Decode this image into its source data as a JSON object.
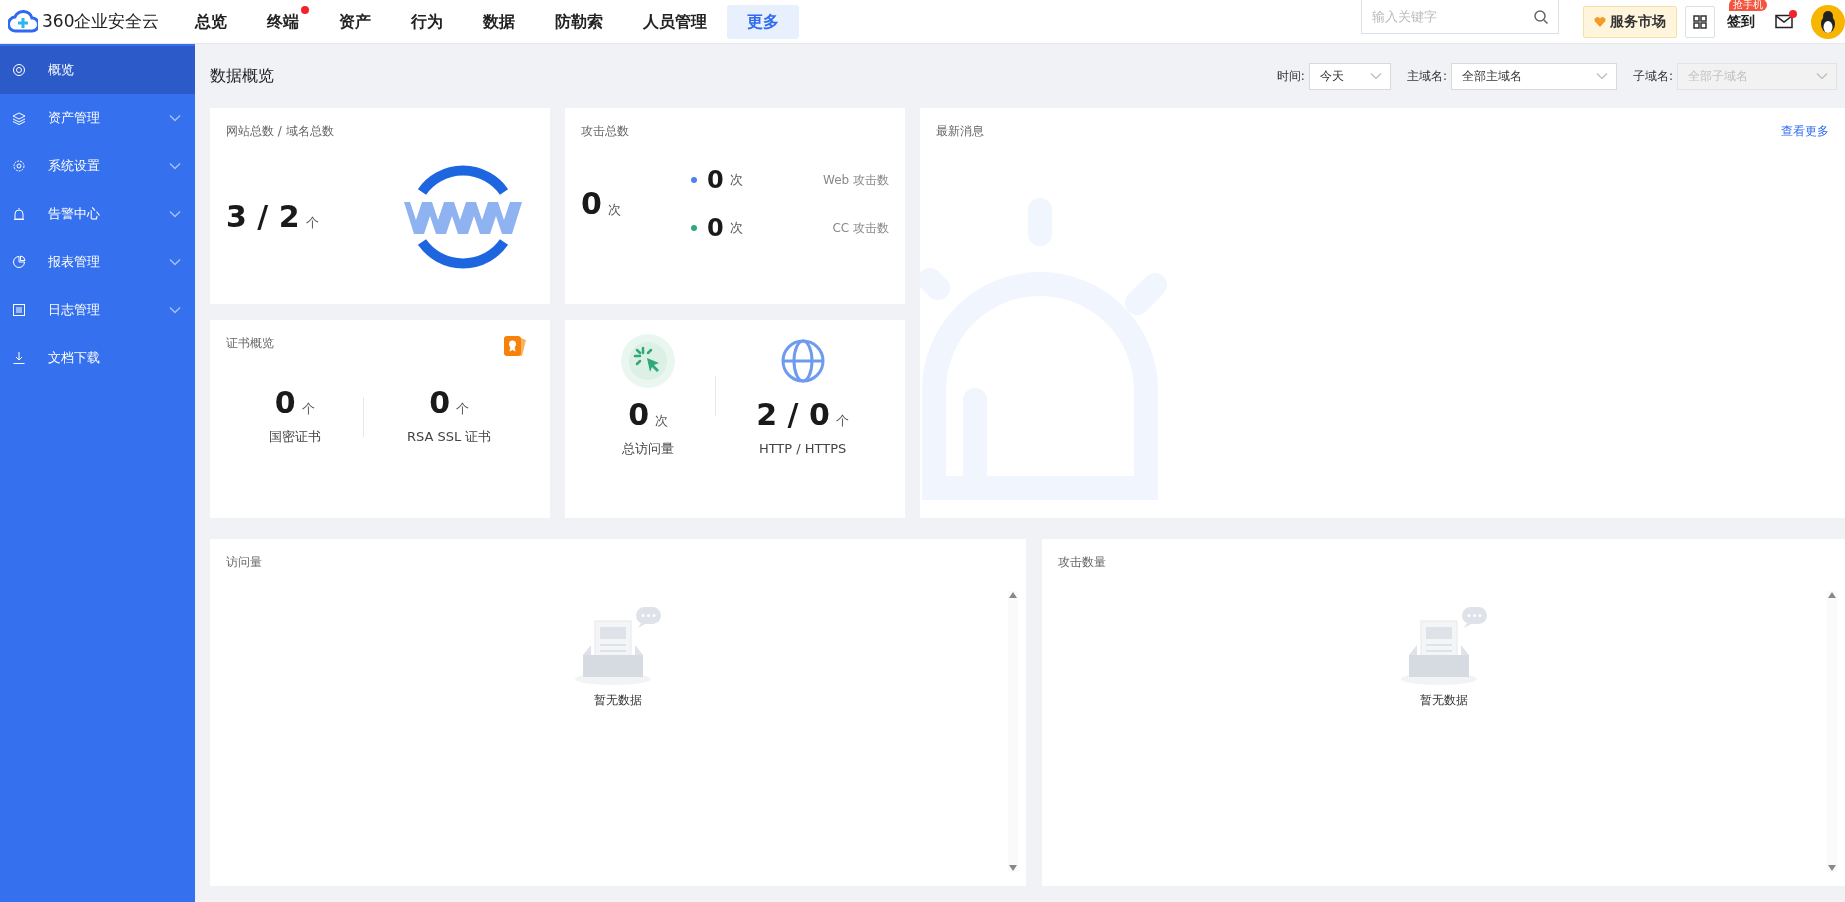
{
  "brand": {
    "name": "360企业安全云"
  },
  "nav": [
    {
      "label": "总览",
      "selected": false,
      "dot": false
    },
    {
      "label": "终端",
      "selected": false,
      "dot": true
    },
    {
      "label": "资产",
      "selected": false,
      "dot": false
    },
    {
      "label": "行为",
      "selected": false,
      "dot": false
    },
    {
      "label": "数据",
      "selected": false,
      "dot": false
    },
    {
      "label": "防勒索",
      "selected": false,
      "dot": false
    },
    {
      "label": "人员管理",
      "selected": false,
      "dot": false
    },
    {
      "label": "更多",
      "selected": true,
      "dot": false
    }
  ],
  "search": {
    "placeholder": "输入关键字"
  },
  "market_button": "服务市场",
  "checkin": {
    "label": "签到",
    "badge": "抢手机"
  },
  "mail": {
    "dot": true
  },
  "sidebar": {
    "items": [
      {
        "label": "概览",
        "selected": true,
        "expandable": false
      },
      {
        "label": "资产管理",
        "selected": false,
        "expandable": true
      },
      {
        "label": "系统设置",
        "selected": false,
        "expandable": true
      },
      {
        "label": "告警中心",
        "selected": false,
        "expandable": true
      },
      {
        "label": "报表管理",
        "selected": false,
        "expandable": true
      },
      {
        "label": "日志管理",
        "selected": false,
        "expandable": true
      },
      {
        "label": "文档下载",
        "selected": false,
        "expandable": false
      }
    ]
  },
  "page_title": "数据概览",
  "filters": [
    {
      "label": "时间:",
      "value": "今天",
      "disabled": false
    },
    {
      "label": "主域名:",
      "value": "全部主域名",
      "disabled": false
    },
    {
      "label": "子域名:",
      "placeholder": "全部子域名",
      "disabled": true
    }
  ],
  "site_card": {
    "title": "网站总数 / 域名总数",
    "value": "3 / 2",
    "unit": "个"
  },
  "attack_card": {
    "title": "攻击总数",
    "value": "0",
    "unit": "次",
    "breakdown": [
      {
        "value": "0",
        "unit": "次",
        "label": "Web 攻击数",
        "color": "#4f7ff0"
      },
      {
        "value": "0",
        "unit": "次",
        "label": "CC 攻击数",
        "color": "#2fa87a"
      }
    ]
  },
  "news_card": {
    "title": "最新消息",
    "more_link": "查看更多"
  },
  "cert_card": {
    "title": "证书概览",
    "items": [
      {
        "value": "0",
        "unit": "个",
        "label": "国密证书"
      },
      {
        "value": "0",
        "unit": "个",
        "label": "RSA SSL 证书"
      }
    ]
  },
  "traffic_card": {
    "items": [
      {
        "value": "0",
        "unit": "次",
        "label": "总访问量"
      },
      {
        "value": "2 / 0",
        "unit": "个",
        "label": "HTTP / HTTPS"
      }
    ]
  },
  "charts": [
    {
      "title": "访问量",
      "empty_text": "暂无数据"
    },
    {
      "title": "攻击数量",
      "empty_text": "暂无数据"
    }
  ]
}
